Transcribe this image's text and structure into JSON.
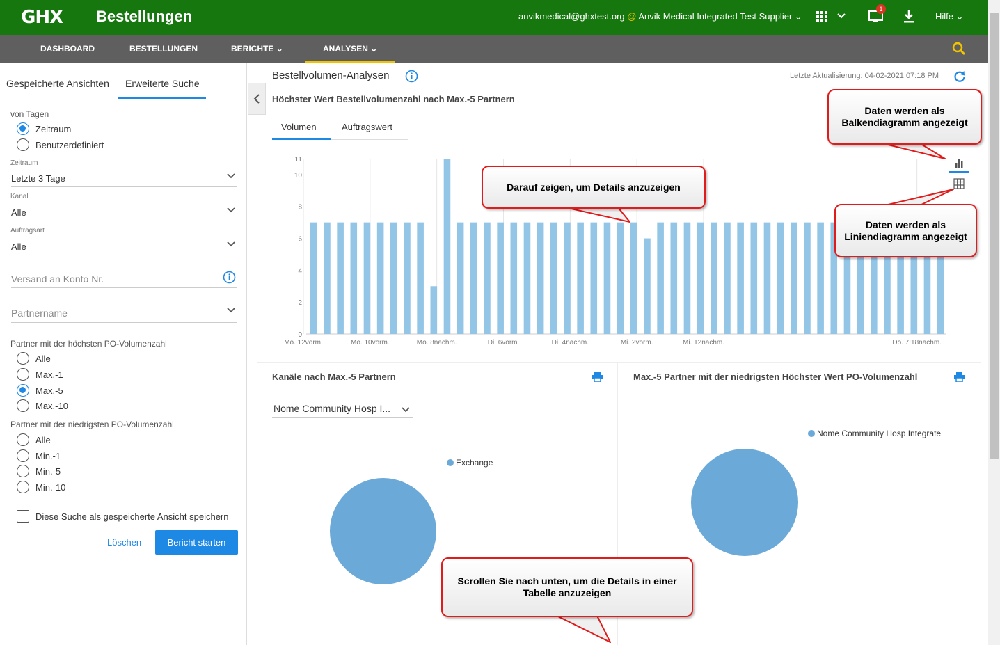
{
  "header": {
    "logo_text": "GHX",
    "app_title": "Bestellungen",
    "account_email": "anvikmedical@ghxtest.org",
    "account_at": "@",
    "account_org": "Anvik Medical Integrated Test Supplier",
    "notification_count": "1",
    "help_label": "Hilfe"
  },
  "nav": {
    "items": [
      "DASHBOARD",
      "BESTELLUNGEN",
      "BERICHTE",
      "ANALYSEN"
    ],
    "active": "ANALYSEN"
  },
  "sidebar": {
    "tabs": [
      "Gespeicherte Ansichten",
      "Erweiterte Suche"
    ],
    "days_label": "von Tagen",
    "days_options": [
      "Zeitraum",
      "Benutzerdefiniert"
    ],
    "period_label": "Zeitraum",
    "period_value": "Letzte 3 Tage",
    "channel_label": "Kanal",
    "channel_value": "Alle",
    "ordertype_label": "Auftragsart",
    "ordertype_value": "Alle",
    "shipto_placeholder": "Versand an Konto Nr.",
    "partner_placeholder": "Partnername",
    "top_label": "Partner mit der höchsten PO-Volumenzahl",
    "top_options": [
      "Alle",
      "Max.-1",
      "Max.-5",
      "Max.-10"
    ],
    "bottom_label": "Partner mit der niedrigsten PO-Volumenzahl",
    "bottom_options": [
      "Alle",
      "Min.-1",
      "Min.-5",
      "Min.-10"
    ],
    "save_label": "Diese Suche als gespeicherte Ansicht speichern",
    "clear_label": "Löschen",
    "run_label": "Bericht starten"
  },
  "main": {
    "title": "Bestellvolumen-Analysen",
    "last_update": "Letzte Aktualisierung: 04-02-2021 07:18 PM",
    "chart_title": "Höchster Wert Bestellvolumenzahl nach Max.-5 Partnern",
    "chart_tabs": [
      "Volumen",
      "Auftragswert"
    ],
    "panel_left_title": "Kanäle nach Max.-5 Partnern",
    "panel_left_select": "Nome Community Hosp I...",
    "panel_right_title": "Max.-5 Partner mit der niedrigsten Höchster Wert PO-Volumenzahl"
  },
  "callouts": {
    "bar": "Daten werden als Balkendiagramm angezeigt",
    "hover": "Darauf zeigen, um Details anzuzeigen",
    "line": "Daten werden als Liniendiagramm angezeigt",
    "scroll": "Scrollen Sie nach unten, um die Details in einer Tabelle anzuzeigen"
  },
  "colors": {
    "brand_green": "#17770f",
    "accent": "#1e88e5",
    "bar": "#92c5e6",
    "pie": "#6aa9d8"
  },
  "chart_data": [
    {
      "type": "bar",
      "title": "Höchster Wert Bestellvolumenzahl nach Max.-5 Partnern",
      "ylim": [
        0,
        11
      ],
      "yticks": [
        0,
        2,
        4,
        6,
        8,
        10,
        11
      ],
      "x_tick_labels": [
        "Mo. 12vorm.",
        "Mo. 10vorm.",
        "Mo. 8nachm.",
        "Di. 6vorm.",
        "Di. 4nachm.",
        "Mi. 2vorm.",
        "Mi. 12nachm.",
        "Do. 7:18nachm."
      ],
      "values": [
        7,
        7,
        7,
        7,
        7,
        7,
        7,
        7,
        7,
        3,
        11,
        7,
        7,
        7,
        7,
        7,
        7,
        7,
        7,
        7,
        7,
        7,
        7,
        7,
        7,
        6,
        7,
        7,
        7,
        7,
        7,
        7,
        7,
        7,
        7,
        7,
        7,
        7,
        7,
        7,
        7,
        7,
        7,
        7,
        7,
        7,
        7,
        7
      ]
    },
    {
      "type": "pie",
      "title": "Kanäle nach Max.-5 Partnern",
      "slices": [
        {
          "label": "Exchange",
          "value": 100
        }
      ]
    },
    {
      "type": "pie",
      "title": "Max.-5 Partner mit der niedrigsten Höchster Wert PO-Volumenzahl",
      "slices": [
        {
          "label": "Nome Community Hosp Integrate",
          "value": 100
        }
      ]
    }
  ]
}
